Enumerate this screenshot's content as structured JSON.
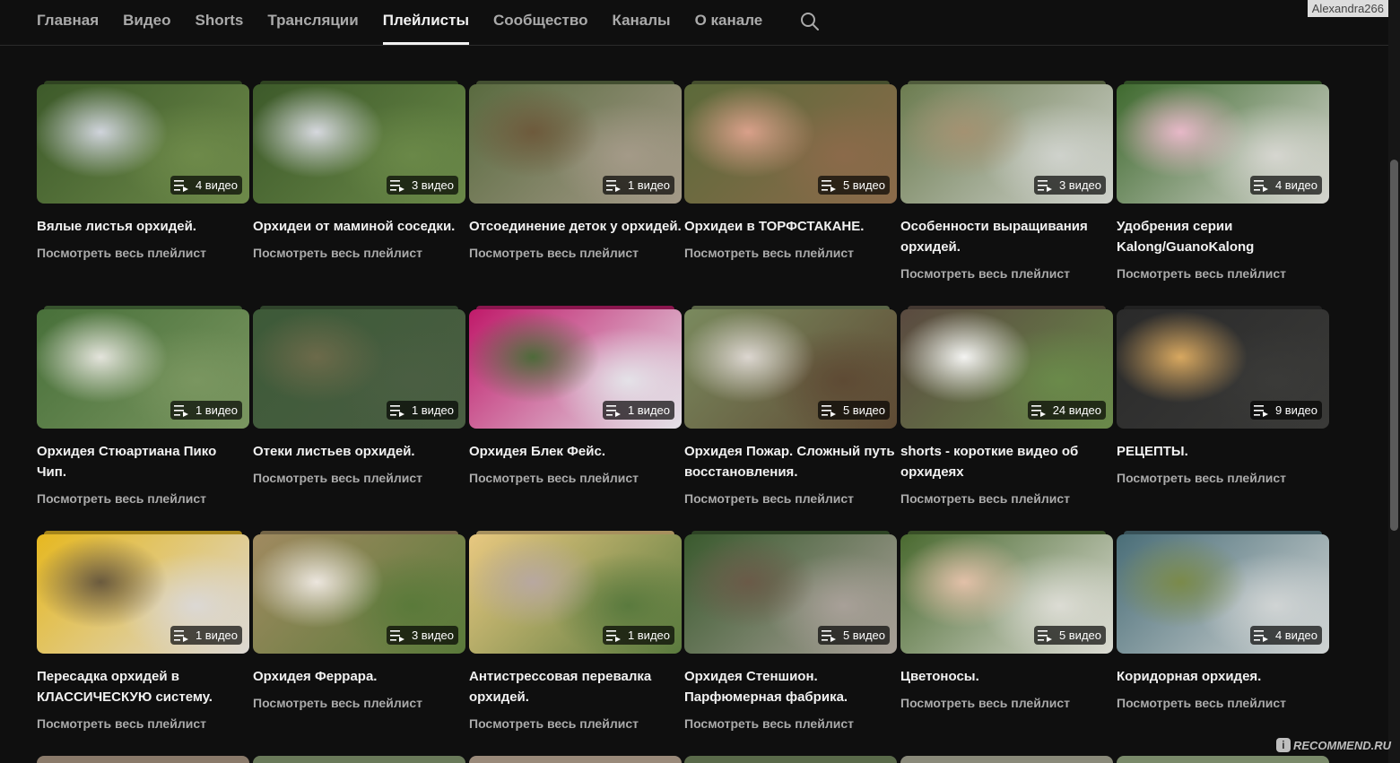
{
  "nav": {
    "tabs": [
      "Главная",
      "Видео",
      "Shorts",
      "Трансляции",
      "Плейлисты",
      "Сообщество",
      "Каналы",
      "О канале"
    ],
    "active_tab": 4,
    "username": "Alexandra266"
  },
  "section": {
    "view_all": "Посмотреть весь плейлист"
  },
  "playlists": [
    {
      "title": "Вялые листья орхидей.",
      "count": "4 видео",
      "colors": [
        "#3d5a2a",
        "#d0d4dc",
        "#6e8a4a"
      ]
    },
    {
      "title": "Орхидеи от маминой соседки.",
      "count": "3 видео",
      "colors": [
        "#3d5a2a",
        "#d6d8de",
        "#6a8848"
      ]
    },
    {
      "title": "Отсоединение деток у орхидей.",
      "count": "1 видео",
      "colors": [
        "#5a6b40",
        "#6e5a3c",
        "#a49a88"
      ]
    },
    {
      "title": "Орхидеи в ТОРФСТАКАНЕ.",
      "count": "5 видео",
      "colors": [
        "#5c6a3a",
        "#d9a08a",
        "#8b6a4a"
      ]
    },
    {
      "title": "Особенности выращивания орхидей.",
      "count": "3 видео",
      "colors": [
        "#6c7c50",
        "#a49272",
        "#cfd2cc"
      ]
    },
    {
      "title": "Удобрения серии Kalong/GuanoKalong",
      "count": "4 видео",
      "colors": [
        "#3f6a2f",
        "#e7b8c8",
        "#d6d6d0"
      ]
    },
    {
      "title": "Орхидея Стюартиана Пико Чип.",
      "count": "1 видео",
      "colors": [
        "#48703a",
        "#e4e4dc",
        "#7a9660"
      ]
    },
    {
      "title": "Отеки листьев орхидей.",
      "count": "1 видео",
      "colors": [
        "#3d5a38",
        "#6c6a4a",
        "#4a5e42"
      ]
    },
    {
      "title": "Орхидея Блек Фейс.",
      "count": "1 видео",
      "colors": [
        "#c01a6a",
        "#4e6a3a",
        "#e4e2e8"
      ]
    },
    {
      "title": "Орхидея Пожар. Сложный путь восстановления.",
      "count": "5 видео",
      "colors": [
        "#7a8a5e",
        "#dcd6d0",
        "#5e4a34"
      ]
    },
    {
      "title": "shorts - короткие видео об орхидеях",
      "count": "24 видео",
      "colors": [
        "#5a4a40",
        "#f4f4f2",
        "#6a8a4a"
      ]
    },
    {
      "title": "РЕЦЕПТЫ.",
      "count": "9 видео",
      "colors": [
        "#2a2a2a",
        "#d8a860",
        "#3a3a38"
      ]
    },
    {
      "title": "Пересадка орхидей в КЛАССИЧЕСКУЮ систему.",
      "count": "1 видео",
      "colors": [
        "#e6b820",
        "#6a5a3e",
        "#dcd8d4"
      ]
    },
    {
      "title": "Орхидея Феррара.",
      "count": "3 видео",
      "colors": [
        "#a08a60",
        "#ece6de",
        "#5a7a3a"
      ]
    },
    {
      "title": "Антистрессовая перевалка орхидей.",
      "count": "1 видео",
      "colors": [
        "#e8c880",
        "#b8a8a0",
        "#5a7a3e"
      ]
    },
    {
      "title": "Орхидея Стеншион. Парфюмерная фабрика.",
      "count": "5 видео",
      "colors": [
        "#3a5a2e",
        "#6a5a48",
        "#a8a098"
      ]
    },
    {
      "title": "Цветоносы.",
      "count": "5 видео",
      "colors": [
        "#4a6a30",
        "#e2c0a8",
        "#dcdcd4"
      ]
    },
    {
      "title": "Коридорная орхидея.",
      "count": "4 видео",
      "colors": [
        "#4a6e78",
        "#7a8a4a",
        "#d0d4d4"
      ]
    }
  ],
  "watermark": "RECOMMEND.RU"
}
